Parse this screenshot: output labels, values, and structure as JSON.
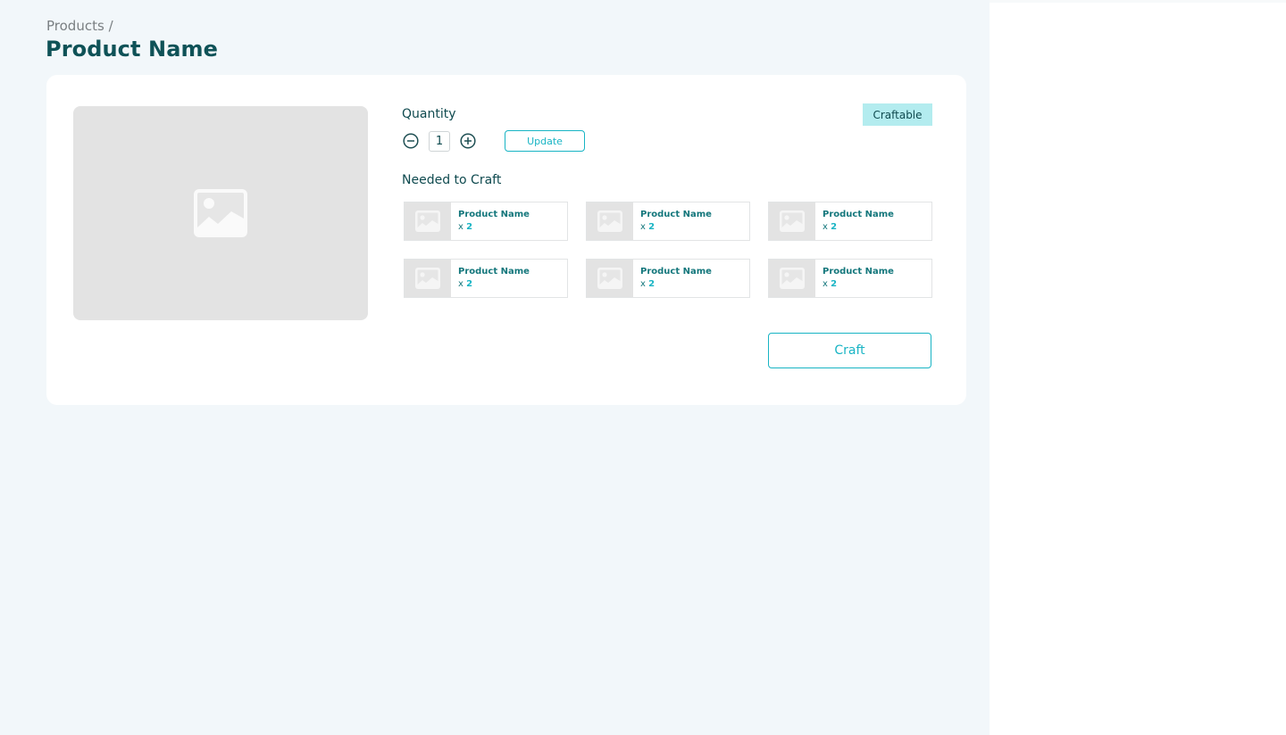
{
  "breadcrumb": {
    "parent": "Products",
    "separator": "/"
  },
  "page_title": "Product Name",
  "product": {
    "image_icon": "image-placeholder-icon",
    "status_badge": "Craftable",
    "quantity": {
      "label": "Quantity",
      "value": "1",
      "decrement_icon": "minus-circle-icon",
      "increment_icon": "plus-circle-icon",
      "update_label": "Update"
    },
    "needed_to_craft": {
      "label": "Needed to Craft",
      "items": [
        {
          "name": "Product Name",
          "qty_prefix": "x",
          "qty": "2"
        },
        {
          "name": "Product Name",
          "qty_prefix": "x",
          "qty": "2"
        },
        {
          "name": "Product Name",
          "qty_prefix": "x",
          "qty": "2"
        },
        {
          "name": "Product Name",
          "qty_prefix": "x",
          "qty": "2"
        },
        {
          "name": "Product Name",
          "qty_prefix": "x",
          "qty": "2"
        },
        {
          "name": "Product Name",
          "qty_prefix": "x",
          "qty": "2"
        }
      ]
    },
    "craft_label": "Craft"
  },
  "colors": {
    "title": "#0f5257",
    "accent": "#18b4c4",
    "badge_bg": "#b3ecef",
    "page_bg": "#f2f7fa",
    "placeholder_bg": "#e3e3e3"
  }
}
